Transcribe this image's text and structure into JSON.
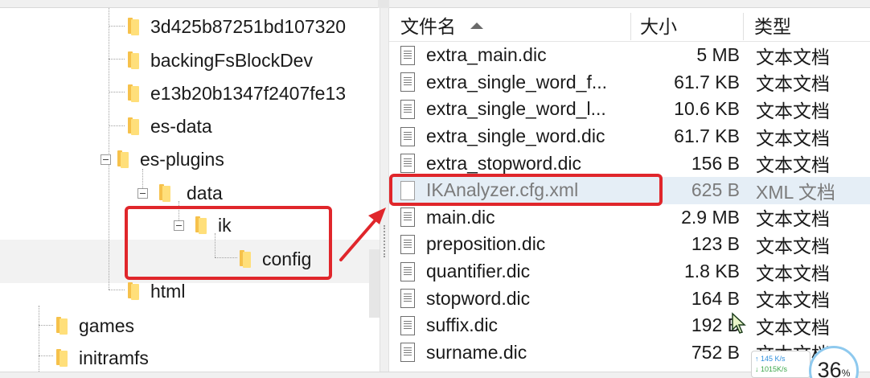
{
  "tree": {
    "items": [
      {
        "label": "3d425b87251bd107320"
      },
      {
        "label": "backingFsBlockDev"
      },
      {
        "label": "e13b20b1347f2407fe13"
      },
      {
        "label": "es-data"
      },
      {
        "label": "es-plugins"
      },
      {
        "label": "data"
      },
      {
        "label": "ik"
      },
      {
        "label": "config"
      },
      {
        "label": "html"
      },
      {
        "label": "games"
      },
      {
        "label": "initramfs"
      }
    ]
  },
  "file_list": {
    "columns": {
      "name": "文件名",
      "size": "大小",
      "type": "类型"
    },
    "rows": [
      {
        "name": "extra_main.dic",
        "size": "5 MB",
        "type": "文本文档"
      },
      {
        "name": "extra_single_word_f...",
        "size": "61.7 KB",
        "type": "文本文档"
      },
      {
        "name": "extra_single_word_l...",
        "size": "10.6 KB",
        "type": "文本文档"
      },
      {
        "name": "extra_single_word.dic",
        "size": "61.7 KB",
        "type": "文本文档"
      },
      {
        "name": "extra_stopword.dic",
        "size": "156 B",
        "type": "文本文档"
      },
      {
        "name": "IKAnalyzer.cfg.xml",
        "size": "625 B",
        "type": "XML 文档"
      },
      {
        "name": "main.dic",
        "size": "2.9 MB",
        "type": "文本文档"
      },
      {
        "name": "preposition.dic",
        "size": "123 B",
        "type": "文本文档"
      },
      {
        "name": "quantifier.dic",
        "size": "1.8 KB",
        "type": "文本文档"
      },
      {
        "name": "stopword.dic",
        "size": "164 B",
        "type": "文本文档"
      },
      {
        "name": "suffix.dic",
        "size": "192 B",
        "type": "文本文档"
      },
      {
        "name": "surname.dic",
        "size": "752 B",
        "type": "文本文档"
      }
    ]
  },
  "net_monitor": {
    "upload": "↑ 145 K/s",
    "download": "↓ 1015K/s",
    "percent": "36",
    "percent_unit": "%"
  },
  "annotation_color": "#e0262b",
  "selection_color": "#e5eef6"
}
